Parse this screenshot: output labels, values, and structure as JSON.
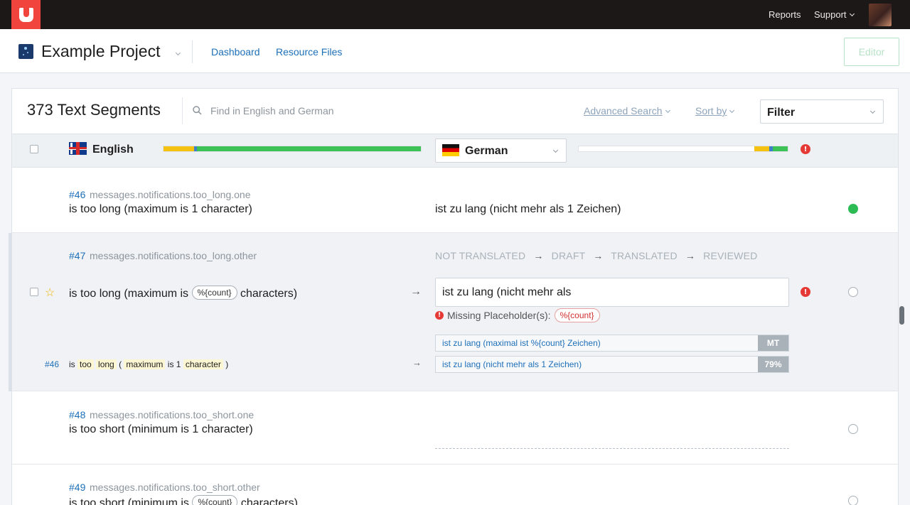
{
  "topbar": {
    "reports": "Reports",
    "support": "Support"
  },
  "project": {
    "title": "Example Project",
    "nav": [
      "Dashboard",
      "Resource Files"
    ],
    "editor_button": "Editor"
  },
  "toolbar": {
    "count_title": "373 Text Segments",
    "search_placeholder": "Find in English and German",
    "advanced_search": "Advanced Search",
    "sort_by": "Sort by",
    "filter": "Filter"
  },
  "languages": {
    "source": {
      "name": "English",
      "progress": {
        "draft": 0.12,
        "translated": 0.01,
        "reviewed": 0.87
      }
    },
    "target": {
      "name": "German",
      "progress": {
        "not_translated": 0.84,
        "draft": 0.07,
        "translated": 0.02,
        "reviewed": 0.07
      }
    }
  },
  "workflow": {
    "steps": [
      "NOT TRANSLATED",
      "DRAFT",
      "TRANSLATED",
      "REVIEWED"
    ],
    "arrow": "→"
  },
  "segments": [
    {
      "id": "#46",
      "key": "messages.notifications.too_long.one",
      "source": "is too long (maximum is 1 character)",
      "target": "ist zu lang (nicht mehr als 1 Zeichen)",
      "status": "reviewed"
    },
    {
      "id": "#47",
      "key": "messages.notifications.too_long.other",
      "source_before": "is too long (maximum is",
      "placeholder": "%{count}",
      "source_after": "characters)",
      "target_input": "ist zu lang (nicht mehr als",
      "warning_label": "Missing Placeholder(s):",
      "warning_placeholder": "%{count}",
      "suggestions": [
        {
          "text": "ist zu lang (maximal ist %{count} Zeichen)",
          "badge": "MT"
        },
        {
          "text": "ist zu lang (nicht mehr als 1 Zeichen)",
          "badge": "79%"
        }
      ],
      "tm_id": "#46",
      "tm_words": [
        "is",
        "too",
        "long",
        "(",
        "maximum",
        "is",
        "1",
        "character",
        ")"
      ],
      "status": "not_translated"
    },
    {
      "id": "#48",
      "key": "messages.notifications.too_short.one",
      "source": "is too short (minimum is 1 character)",
      "status": "not_translated"
    },
    {
      "id": "#49",
      "key": "messages.notifications.too_short.other",
      "source_before": "is too short (minimum is",
      "placeholder": "%{count}",
      "source_after": "characters)",
      "status": "not_translated"
    }
  ],
  "colors": {
    "draft": "#f5c211",
    "translated": "#3f7fc7",
    "reviewed": "#3cc257",
    "not_translated": "#ffffff",
    "accent": "#f0443d",
    "link": "#1d6fb8"
  }
}
